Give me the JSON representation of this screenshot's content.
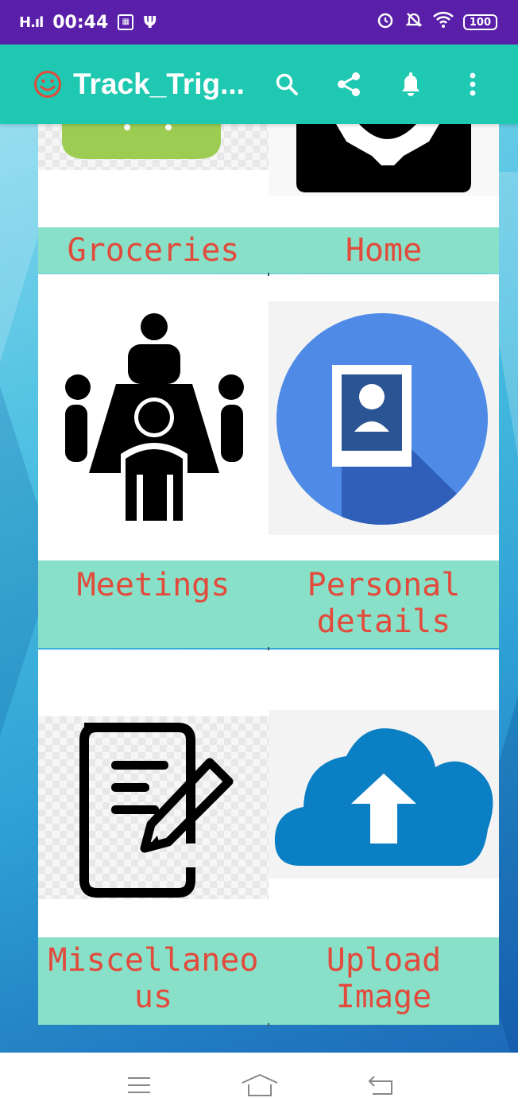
{
  "status_bar": {
    "signal": "H.ıl",
    "time": "00:44",
    "battery": "100"
  },
  "app_bar": {
    "title": "Track_Trig...",
    "actions": [
      "search-icon",
      "share-icon",
      "bell-icon",
      "more-vert-icon"
    ]
  },
  "tiles": [
    {
      "label": "Groceries",
      "icon": "groceries-icon"
    },
    {
      "label": "Home",
      "icon": "home-settings-icon"
    },
    {
      "label": "Meetings",
      "icon": "meetings-icon"
    },
    {
      "label": "Personal details",
      "icon": "personal-details-icon"
    },
    {
      "label": "Miscellaneous",
      "icon": "miscellaneous-icon"
    },
    {
      "label": "Upload Image",
      "icon": "upload-cloud-icon"
    }
  ],
  "labels_wrapped": {
    "personal_line1": "Personal",
    "personal_line2": "details",
    "misc_line1": "Miscellaneo",
    "misc_line2": "us",
    "upload_line1": "Upload",
    "upload_line2": "Image"
  },
  "nav_bar": [
    "menu-icon",
    "home-icon",
    "back-icon"
  ],
  "colors": {
    "status_bar": "#5a1fa8",
    "app_bar": "#1fc8b1",
    "label_band": "#88e0c8",
    "label_text": "#e24a3b"
  }
}
